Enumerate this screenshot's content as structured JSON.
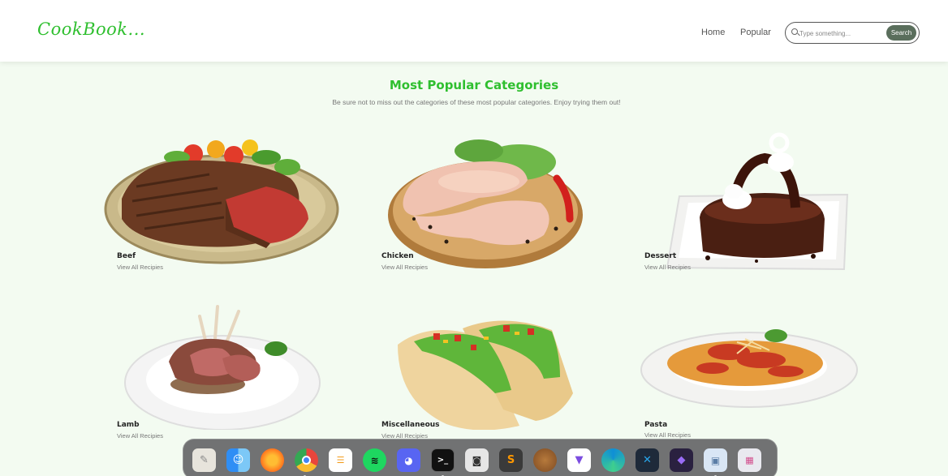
{
  "header": {
    "logo": "CookBook...",
    "nav": [
      {
        "label": "Home"
      },
      {
        "label": "Popular"
      }
    ],
    "search": {
      "placeholder": "Type something...",
      "button_label": "Search"
    }
  },
  "section": {
    "title": "Most Popular Categories",
    "subtitle": "Be sure not to miss out the categories of these most popular categories. Enjoy trying them out!"
  },
  "categories": [
    {
      "name": "Beef",
      "link": "View All Recipies"
    },
    {
      "name": "Chicken",
      "link": "View All Recipies"
    },
    {
      "name": "Dessert",
      "link": "View All Recipies"
    },
    {
      "name": "Lamb",
      "link": "View All Recipies"
    },
    {
      "name": "Miscellaneous",
      "link": "View All Recipies"
    },
    {
      "name": "Pasta",
      "link": "View All Recipies"
    }
  ],
  "colors": {
    "brand_green": "#2fbf2f",
    "page_background": "#f3fbf1",
    "search_button": "#5a6e5c"
  },
  "dock": {
    "apps": [
      {
        "icon": "notes-icon"
      },
      {
        "icon": "finder-icon"
      },
      {
        "icon": "firefox-icon"
      },
      {
        "icon": "chrome-icon"
      },
      {
        "icon": "reminders-icon"
      },
      {
        "icon": "spotify-icon"
      },
      {
        "icon": "discord-icon"
      },
      {
        "icon": "terminal-icon"
      },
      {
        "icon": "screenshot-icon"
      },
      {
        "icon": "sublime-icon"
      },
      {
        "icon": "tor-icon"
      },
      {
        "icon": "vpn-icon"
      },
      {
        "icon": "edge-icon"
      },
      {
        "icon": "vscode-icon"
      },
      {
        "icon": "obsidian-icon"
      },
      {
        "icon": "preview-icon"
      },
      {
        "icon": "launchpad-icon"
      }
    ]
  }
}
